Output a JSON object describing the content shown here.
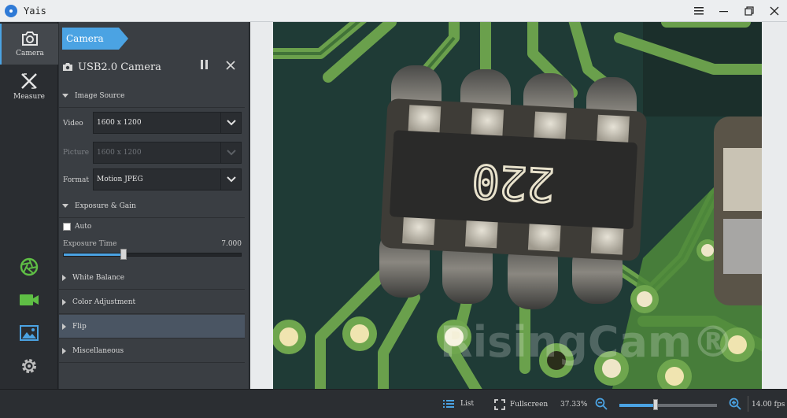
{
  "window": {
    "title": "Yais"
  },
  "nav": {
    "items": [
      {
        "label": "Camera",
        "icon": "camera-icon",
        "active": true
      },
      {
        "label": "Measure",
        "icon": "measure-icon",
        "active": false
      }
    ],
    "side_icons": [
      "aperture-icon",
      "video-icon",
      "image-icon",
      "settings-icon"
    ]
  },
  "panel": {
    "tab_label": "Camera",
    "camera_name": "USB2.0 Camera",
    "sections": {
      "image_source": "Image Source",
      "exposure_gain": "Exposure & Gain",
      "white_balance": "White Balance",
      "color_adjustment": "Color Adjustment",
      "flip": "Flip",
      "miscellaneous": "Miscellaneous"
    },
    "fields": {
      "video_label": "Video",
      "video_value": "1600 x 1200",
      "picture_label": "Picture",
      "picture_value": "1600 x 1200",
      "format_label": "Format",
      "format_value": "Motion JPEG"
    },
    "exposure": {
      "auto_label": "Auto",
      "auto_checked": false,
      "time_label": "Exposure Time",
      "time_value": "7.000",
      "slider_fraction": 0.34
    }
  },
  "viewport": {
    "component_marking": "220",
    "watermark": "RisingCam®"
  },
  "statusbar": {
    "list_label": "List",
    "fullscreen_label": "Fullscreen",
    "zoom_value": "37.33%",
    "zoom_fraction": 0.37,
    "fps_value": "14.00 fps"
  },
  "colors": {
    "accent": "#4ba3e3",
    "side_icon_green": "#5fbf45",
    "side_icon_blue": "#4ba3e3",
    "pcb_green": "#1e3a35",
    "trace_green": "#6fa64e"
  }
}
